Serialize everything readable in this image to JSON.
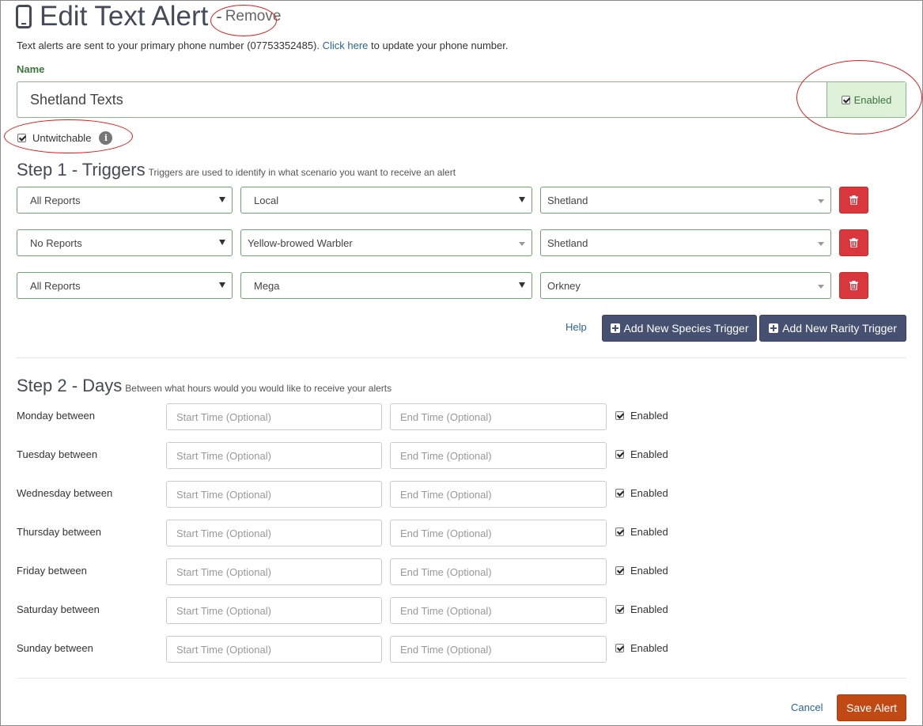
{
  "header": {
    "title": "Edit Text Alert",
    "separator": "-",
    "remove_label": "Remove",
    "info_prefix": "Text alerts are sent to your primary phone number (07753352485). ",
    "info_link": "Click here",
    "info_suffix": " to update your phone number."
  },
  "name_section": {
    "label": "Name",
    "value": "Shetland Texts",
    "enabled_label": "Enabled",
    "enabled_checked": true
  },
  "untwitchable": {
    "label": "Untwitchable",
    "checked": true,
    "info_glyph": "i"
  },
  "step1": {
    "title": "Step 1 - Triggers",
    "subtitle": "Triggers are used to identify in what scenario you want to receive an alert",
    "triggers": [
      {
        "reports": "All Reports",
        "species": "Local",
        "region": "Shetland"
      },
      {
        "reports": "No Reports",
        "species": "Yellow-browed Warbler",
        "region": "Shetland"
      },
      {
        "reports": "All Reports",
        "species": "Mega",
        "region": "Orkney"
      }
    ],
    "help_label": "Help",
    "add_species_label": "Add New Species Trigger",
    "add_rarity_label": "Add New Rarity Trigger"
  },
  "step2": {
    "title": "Step 2 - Days",
    "subtitle": "Between what hours would you would like to receive your alerts",
    "start_placeholder": "Start Time (Optional)",
    "end_placeholder": "End Time (Optional)",
    "enabled_label": "Enabled",
    "days": [
      {
        "label": "Monday between",
        "enabled": true
      },
      {
        "label": "Tuesday between",
        "enabled": true
      },
      {
        "label": "Wednesday between",
        "enabled": true
      },
      {
        "label": "Thursday between",
        "enabled": true
      },
      {
        "label": "Friday between",
        "enabled": true
      },
      {
        "label": "Saturday between",
        "enabled": true
      },
      {
        "label": "Sunday between",
        "enabled": true
      }
    ]
  },
  "footer": {
    "cancel_label": "Cancel",
    "save_label": "Save Alert"
  },
  "colors": {
    "title": "#444a58",
    "success_border": "#6ea56e",
    "success_bg": "#dff0d8",
    "danger": "#d9363e",
    "primary_dark": "#465070",
    "save": "#c14a14",
    "link": "#2a6496",
    "annotation_ellipse": "#e31b1b"
  },
  "icons": {
    "title_icon": "mobile-phone-icon",
    "delete_icon": "trash-icon",
    "add_icon": "plus-square-icon",
    "info_icon": "info-circle-icon"
  }
}
